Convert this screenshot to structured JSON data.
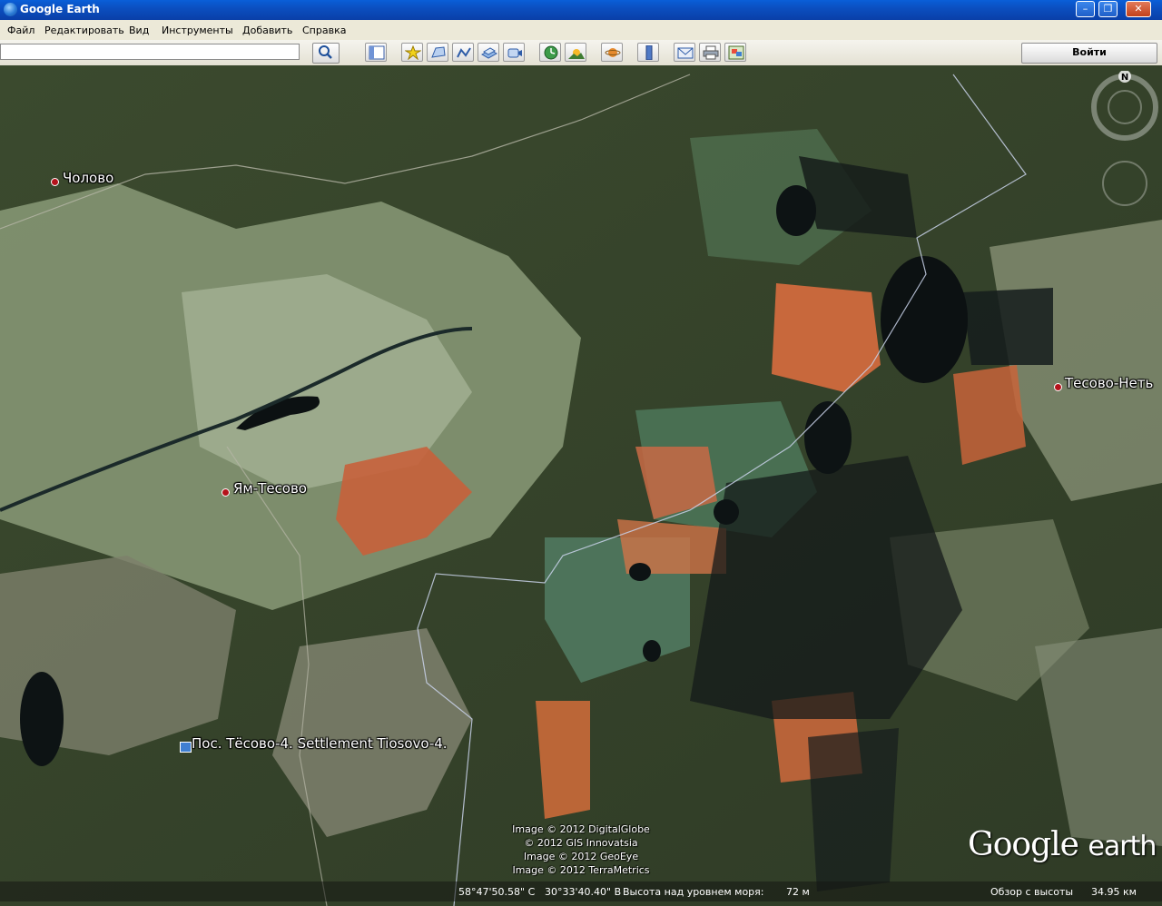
{
  "window": {
    "title": "Google Earth"
  },
  "menu": {
    "items": [
      "Файл",
      "Редактировать",
      "Вид",
      "Инструменты",
      "Добавить",
      "Справка"
    ]
  },
  "toolbar": {
    "search_value": "",
    "signin_label": "Войти",
    "buttons": [
      "sidebar-icon",
      "placemark-icon",
      "polygon-icon",
      "path-icon",
      "image-overlay-icon",
      "record-tour-icon",
      "historical-imagery-icon",
      "sunlight-icon",
      "planets-icon",
      "ruler-icon",
      "email-icon",
      "print-icon",
      "view-in-maps-icon"
    ]
  },
  "map": {
    "places": [
      {
        "name": "Чолово",
        "kind": "town"
      },
      {
        "name": "Ям-Тесово",
        "kind": "town"
      },
      {
        "name": "Тесово-Неть",
        "kind": "town"
      },
      {
        "name": "Пос. Тёсово-4. Settlement Tiosovo-4.",
        "kind": "settlement"
      }
    ],
    "compass_letter": "N",
    "credits": [
      "Image © 2012 DigitalGlobe",
      "© 2012 GIS Innovatsia",
      "Image © 2012 GeoEye",
      "Image © 2012 TerraMetrics"
    ],
    "logo_word1": "Google",
    "logo_word2": "earth"
  },
  "status": {
    "lat": "58°47'50.58\" С",
    "lon": "30°33'40.40\" В",
    "elevation_label": "Высота над уровнем моря:",
    "elevation_value": "72 м",
    "eye_label": "Обзор с высоты",
    "eye_value": "34.95 км"
  }
}
